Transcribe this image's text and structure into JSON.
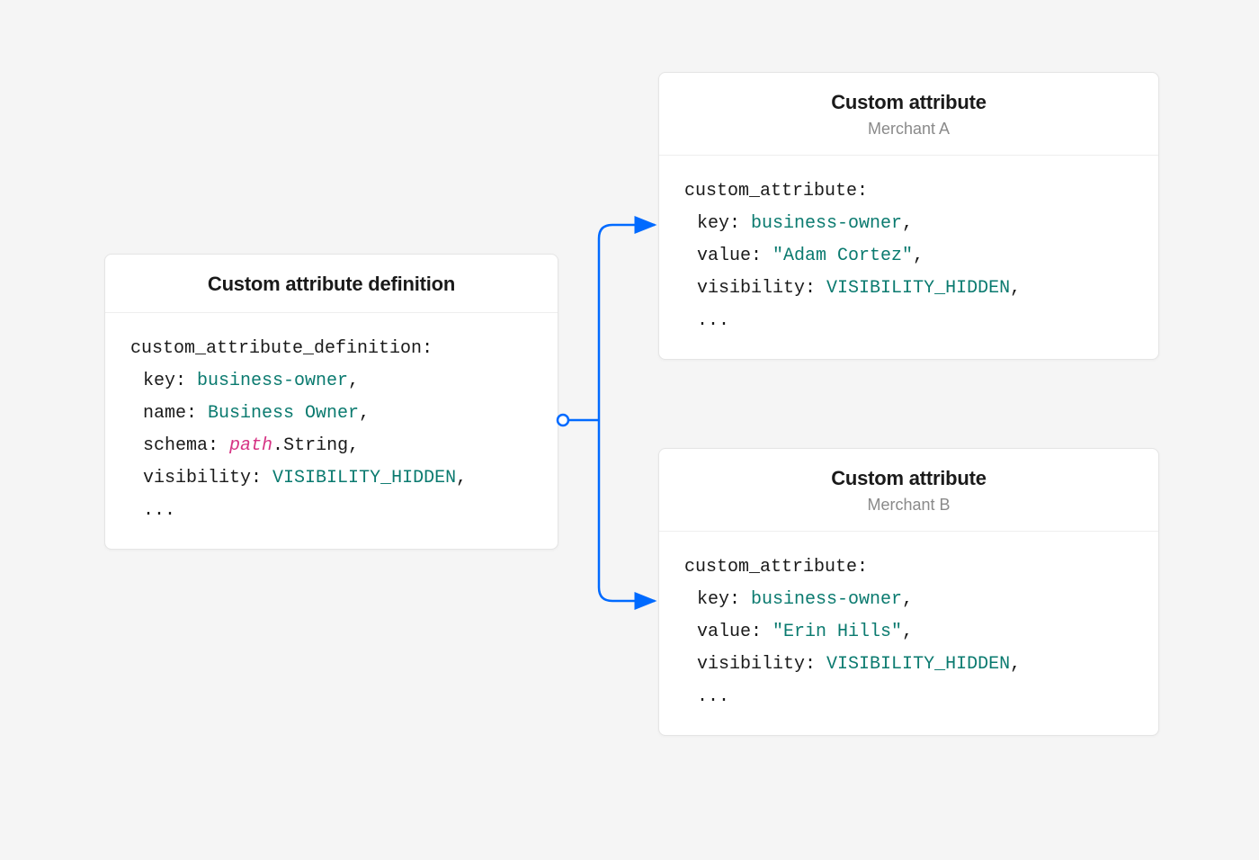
{
  "definition": {
    "title": "Custom attribute definition",
    "object_label": "custom_attribute_definition",
    "key_label": "key",
    "key_value": "business-owner",
    "name_label": "name",
    "name_value": "Business Owner",
    "schema_label": "schema",
    "schema_path": "path",
    "schema_type": "String",
    "visibility_label": "visibility",
    "visibility_value": "VISIBILITY_HIDDEN",
    "ellipsis": "..."
  },
  "attr_a": {
    "title": "Custom attribute",
    "subtitle": "Merchant A",
    "object_label": "custom_attribute",
    "key_label": "key",
    "key_value": "business-owner",
    "value_label": "value",
    "value_value": "\"Adam Cortez\"",
    "visibility_label": "visibility",
    "visibility_value": "VISIBILITY_HIDDEN",
    "ellipsis": "..."
  },
  "attr_b": {
    "title": "Custom attribute",
    "subtitle": "Merchant B",
    "object_label": "custom_attribute",
    "key_label": "key",
    "key_value": "business-owner",
    "value_label": "value",
    "value_value": "\"Erin Hills\"",
    "visibility_label": "visibility",
    "visibility_value": "VISIBILITY_HIDDEN",
    "ellipsis": "..."
  }
}
